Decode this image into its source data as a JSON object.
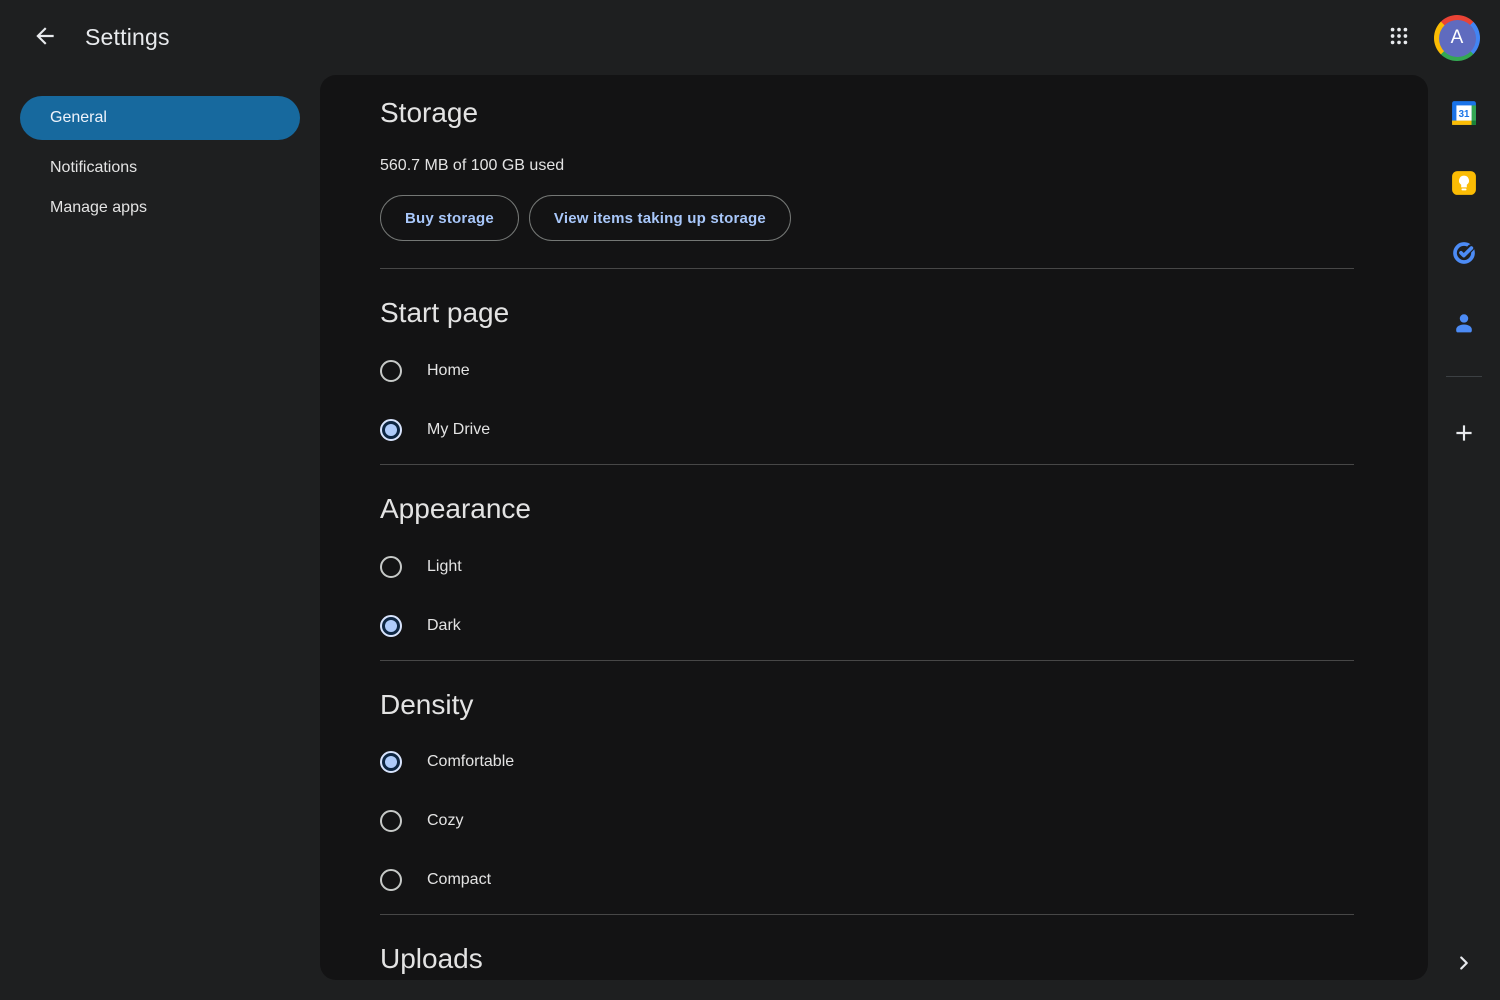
{
  "topbar": {
    "title": "Settings",
    "avatar_letter": "A"
  },
  "sidebar": {
    "items": [
      {
        "label": "General",
        "active": true
      },
      {
        "label": "Notifications",
        "active": false
      },
      {
        "label": "Manage apps",
        "active": false
      }
    ]
  },
  "main": {
    "storage": {
      "title": "Storage",
      "usage": "560.7 MB of 100 GB used",
      "buttons": [
        {
          "label": "Buy storage"
        },
        {
          "label": "View items taking up storage"
        }
      ]
    },
    "start_page": {
      "title": "Start page",
      "options": [
        {
          "label": "Home",
          "selected": false
        },
        {
          "label": "My Drive",
          "selected": true
        }
      ]
    },
    "appearance": {
      "title": "Appearance",
      "options": [
        {
          "label": "Light",
          "selected": false
        },
        {
          "label": "Dark",
          "selected": true
        }
      ]
    },
    "density": {
      "title": "Density",
      "options": [
        {
          "label": "Comfortable",
          "selected": true
        },
        {
          "label": "Cozy",
          "selected": false
        },
        {
          "label": "Compact",
          "selected": false
        }
      ]
    },
    "uploads": {
      "title": "Uploads"
    }
  },
  "side_rail": {
    "icons": [
      "calendar",
      "keep",
      "tasks",
      "contacts",
      "add",
      "expand"
    ],
    "calendar_day": "31"
  },
  "colors": {
    "outer_bg": "#1e1f20",
    "panel_bg": "#131314",
    "active_pill": "#17699e",
    "accent_text": "#a8c7fa",
    "radio_selected_dot": "#aecbfa",
    "text_primary": "#e3e3e3",
    "divider": "#474747"
  }
}
